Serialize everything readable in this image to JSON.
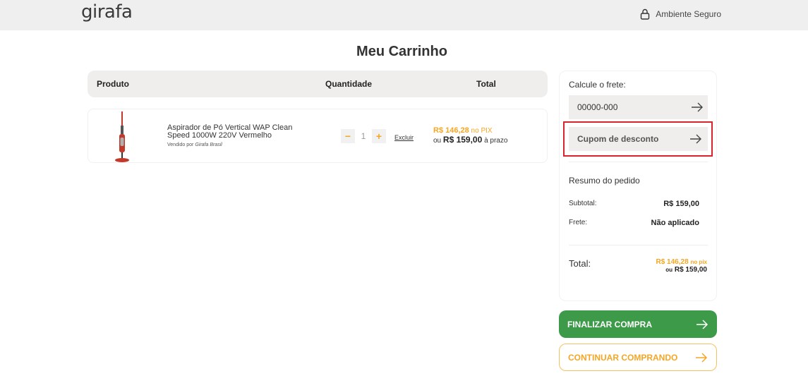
{
  "header": {
    "logo_text": "girafa",
    "secure_label": "Ambiente Seguro",
    "secure_icon": "lock-icon"
  },
  "page": {
    "title": "Meu Carrinho"
  },
  "cart_table": {
    "headers": [
      "Produto",
      "Quantidade",
      "Total"
    ]
  },
  "cart_item": {
    "name": "Aspirador de Pó Vertical WAP Clean Speed 1000W 220V Vermelho",
    "seller_prefix": "Vendido por",
    "seller_name": "Girafa Brasil",
    "quantity": "1",
    "decrease_label": "−",
    "increase_label": "+",
    "remove_label": "Excluir",
    "pix_price": "R$ 146,28",
    "pix_label": "no PIX",
    "installment_prefix": "ou",
    "installment_price": "R$ 159,00",
    "installment_suffix": "à prazo"
  },
  "sidebar": {
    "freight_label": "Calcule o frete:",
    "cep_value": "00000-000",
    "coupon_placeholder": "Cupom de desconto",
    "summary_title": "Resumo do pedido",
    "subtotal_label": "Subtotal:",
    "subtotal_value": "R$ 159,00",
    "freight_row_label": "Frete:",
    "freight_row_value": "Não aplicado",
    "total_label": "Total:",
    "total_pix_price": "R$ 146,28",
    "total_pix_label": "no pix",
    "total_prazo_prefix": "ou",
    "total_prazo_price": "R$ 159,00"
  },
  "actions": {
    "finish_label": "FINALIZAR COMPRA",
    "continue_label": "CONTINUAR COMPRANDO"
  },
  "colors": {
    "accent_orange": "#f5a623",
    "finish_green": "#3c9a48",
    "highlight_red": "#d9232d"
  }
}
